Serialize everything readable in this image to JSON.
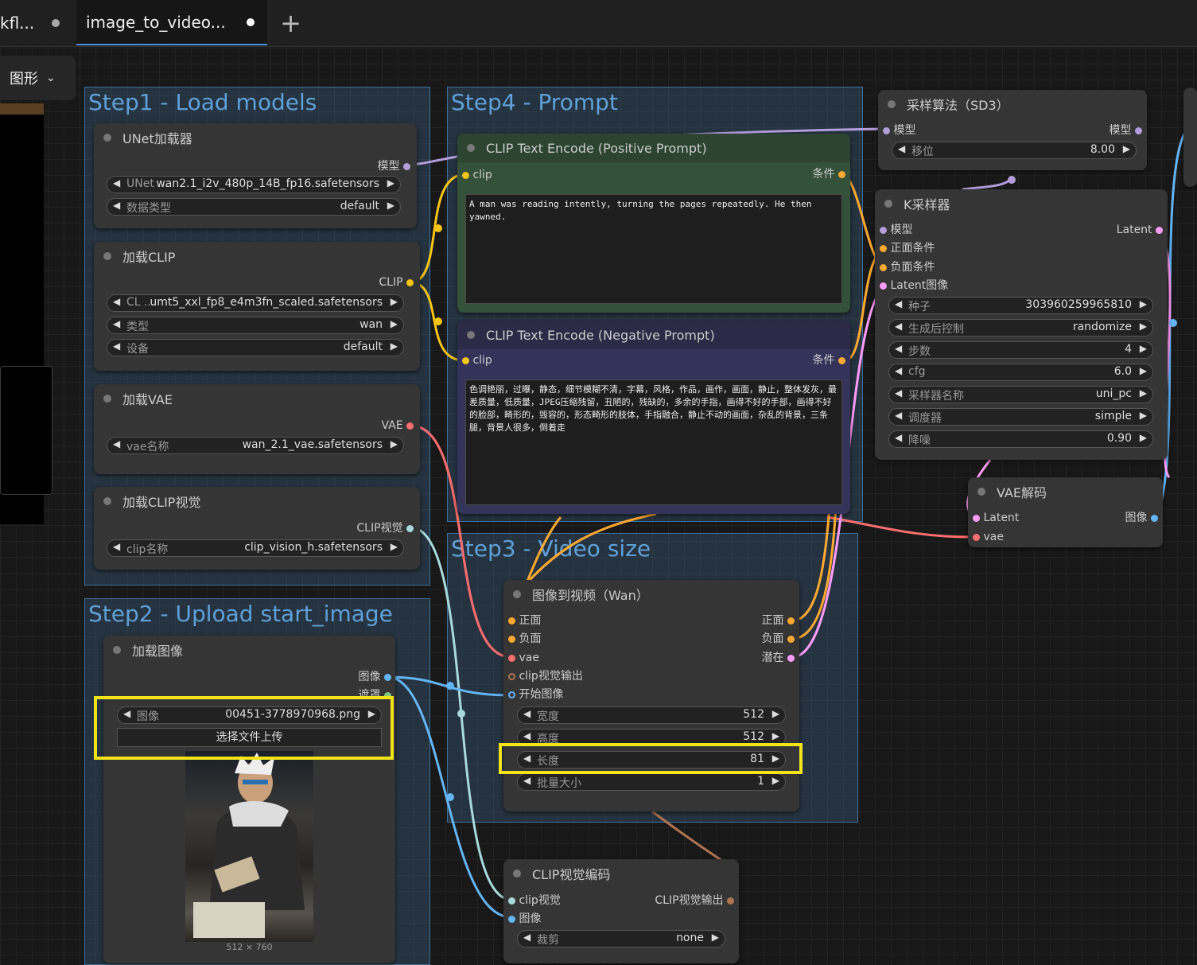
{
  "tabs": [
    {
      "label": "kfl..."
    },
    {
      "label": "image_to_video..."
    }
  ],
  "add_tab_label": "+",
  "view_menu": {
    "label": "图形",
    "icon": "chevron-down-icon"
  },
  "groups": {
    "step1": "Step1 - Load models",
    "step2": "Step2 - Upload start_image",
    "step3": "Step3 - Video size",
    "step4": "Step4 - Prompt"
  },
  "unet_loader": {
    "title": "UNet加载器",
    "out": "模型",
    "w1_label": "UNet ...",
    "w1_value": "wan2.1_i2v_480p_14B_fp16.safetensors",
    "w2_label": "数据类型",
    "w2_value": "default"
  },
  "clip_loader": {
    "title": "加载CLIP",
    "out": "CLIP",
    "w1_label": "CL ...",
    "w1_value": "umt5_xxl_fp8_e4m3fn_scaled.safetensors",
    "w2_label": "类型",
    "w2_value": "wan",
    "w3_label": "设备",
    "w3_value": "default"
  },
  "vae_loader": {
    "title": "加载VAE",
    "out": "VAE",
    "w1_label": "vae名称",
    "w1_value": "wan_2.1_vae.safetensors"
  },
  "clip_vision_loader": {
    "title": "加载CLIP视觉",
    "out": "CLIP视觉",
    "w1_label": "clip名称",
    "w1_value": "clip_vision_h.safetensors"
  },
  "load_image": {
    "title": "加载图像",
    "out1": "图像",
    "out2": "遮罩",
    "w1_label": "图像",
    "w1_value": "00451-3778970968.png",
    "upload_label": "选择文件上传",
    "size_text": "512 × 760"
  },
  "positive": {
    "title": "CLIP Text Encode (Positive Prompt)",
    "in": "clip",
    "out": "条件",
    "text": "A man was reading intently, turning the pages repeatedly. He then yawned."
  },
  "negative": {
    "title": "CLIP Text Encode (Negative Prompt)",
    "in": "clip",
    "out": "条件",
    "text": "色调艳丽，过曝，静态，细节模糊不清，字幕，风格，作品，画作，画面，静止，整体发灰，最差质量，低质量，JPEG压缩残留，丑陋的，残缺的，多余的手指，画得不好的手部，画得不好的脸部，畸形的，毁容的，形态畸形的肢体，手指融合，静止不动的画面，杂乱的背景，三条腿，背景人很多，倒着走"
  },
  "image_to_video": {
    "title": "图像到视频（Wan）",
    "in1": "正面",
    "in2": "负面",
    "in3": "vae",
    "in4": "clip视觉输出",
    "in5": "开始图像",
    "out1": "正面",
    "out2": "负面",
    "out3": "潜在",
    "w_width_label": "宽度",
    "w_width_value": "512",
    "w_height_label": "高度",
    "w_height_value": "512",
    "w_length_label": "长度",
    "w_length_value": "81",
    "w_batch_label": "批量大小",
    "w_batch_value": "1"
  },
  "clip_vision_encode": {
    "title": "CLIP视觉编码",
    "in1": "clip视觉",
    "in2": "图像",
    "out": "CLIP视觉输出",
    "w1_label": "裁剪",
    "w1_value": "none"
  },
  "sampling_sd3": {
    "title": "采样算法（SD3）",
    "in": "模型",
    "out": "模型",
    "w1_label": "移位",
    "w1_value": "8.00"
  },
  "ksampler": {
    "title": "K采样器",
    "in1": "模型",
    "in2": "正面条件",
    "in3": "负面条件",
    "in4": "Latent图像",
    "out": "Latent",
    "w_seed_label": "种子",
    "w_seed_value": "303960259965810",
    "w_ctrl_label": "生成后控制",
    "w_ctrl_value": "randomize",
    "w_steps_label": "步数",
    "w_steps_value": "4",
    "w_cfg_label": "cfg",
    "w_cfg_value": "6.0",
    "w_sampler_label": "采样器名称",
    "w_sampler_value": "uni_pc",
    "w_sched_label": "调度器",
    "w_sched_value": "simple",
    "w_denoise_label": "降噪",
    "w_denoise_value": "0.90"
  },
  "vae_decode": {
    "title": "VAE解码",
    "in1": "Latent",
    "in2": "vae",
    "out": "图像"
  },
  "colors": {
    "model": "#b39ddb",
    "clip": "#f5c518",
    "vae": "#ff6e6e",
    "cond": "#ffa931",
    "latent": "#ff9cf9",
    "image": "#64b5f6",
    "clip_vision": "#a8dadc",
    "clip_vision_out": "#ad7452",
    "highlight": "#f2e31a"
  }
}
